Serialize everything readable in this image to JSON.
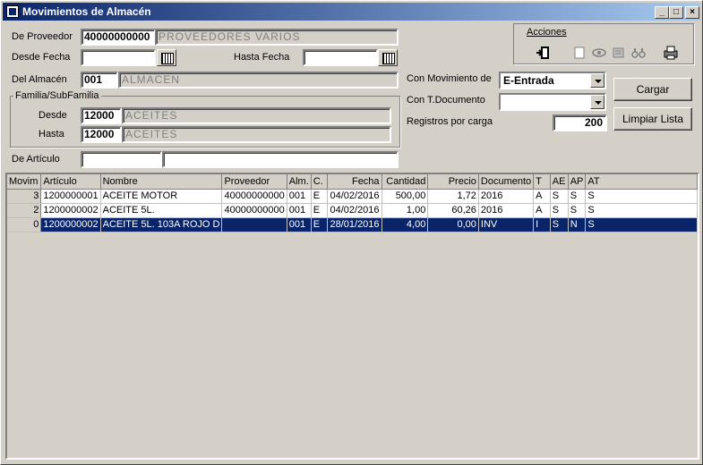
{
  "window": {
    "title": "Movimientos de Almacén"
  },
  "filters": {
    "proveedor_label": "De Proveedor",
    "proveedor_code": "40000000000",
    "proveedor_name": "PROVEEDORES VARIOS",
    "desde_fecha_label": "Desde Fecha",
    "desde_fecha": "",
    "hasta_fecha_label": "Hasta Fecha",
    "hasta_fecha": "",
    "almacen_label": "Del Almacén",
    "almacen_code": "001",
    "almacen_name": "ALMACEN",
    "familia_group": "Familia/SubFamilia",
    "familia_desde_label": "Desde",
    "familia_desde_code": "12000",
    "familia_desde_name": "ACEITES",
    "familia_hasta_label": "Hasta",
    "familia_hasta_code": "12000",
    "familia_hasta_name": "ACEITES",
    "articulo_label": "De Artículo",
    "articulo_code": "",
    "articulo_name": "",
    "movimiento_label": "Con Movimiento de",
    "movimiento_value": "E-Entrada",
    "tdocumento_label": "Con T.Documento",
    "tdocumento_value": "",
    "registros_label": "Registros por carga",
    "registros_value": "200"
  },
  "actions": {
    "menu_label": "Acciones",
    "cargar": "Cargar",
    "limpiar": "Limpiar Lista",
    "icons": [
      "exit-icon",
      "document-icon",
      "eye-icon",
      "refresh-icon",
      "binoculars-icon",
      "printer-icon"
    ]
  },
  "grid": {
    "columns": [
      "Movim",
      "Artículo",
      "Nombre",
      "Proveedor",
      "Alm.",
      "C.",
      "Fecha",
      "Cantidad",
      "Precio",
      "Documento",
      "T",
      "AE",
      "AP",
      "AT"
    ],
    "rows": [
      [
        "3",
        "1200000001",
        "ACEITE MOTOR",
        "40000000000",
        "001",
        "E",
        "04/02/2016",
        "500,00",
        "1,72",
        "2016",
        "A",
        "S",
        "S",
        "S"
      ],
      [
        "2",
        "1200000002",
        "ACEITE 5L.",
        "40000000000",
        "001",
        "E",
        "04/02/2016",
        "1,00",
        "60,26",
        "2016",
        "A",
        "S",
        "S",
        "S"
      ],
      [
        "0",
        "1200000002",
        "ACEITE 5L. 103A ROJO D",
        "",
        "001",
        "E",
        "28/01/2016",
        "4,00",
        "0,00",
        "INV",
        "I",
        "S",
        "N",
        "S"
      ]
    ],
    "selected_row": 2
  },
  "colors": {
    "title_bar": "#0a246a",
    "selection": "#0a246a",
    "face": "#d4d0c8"
  }
}
